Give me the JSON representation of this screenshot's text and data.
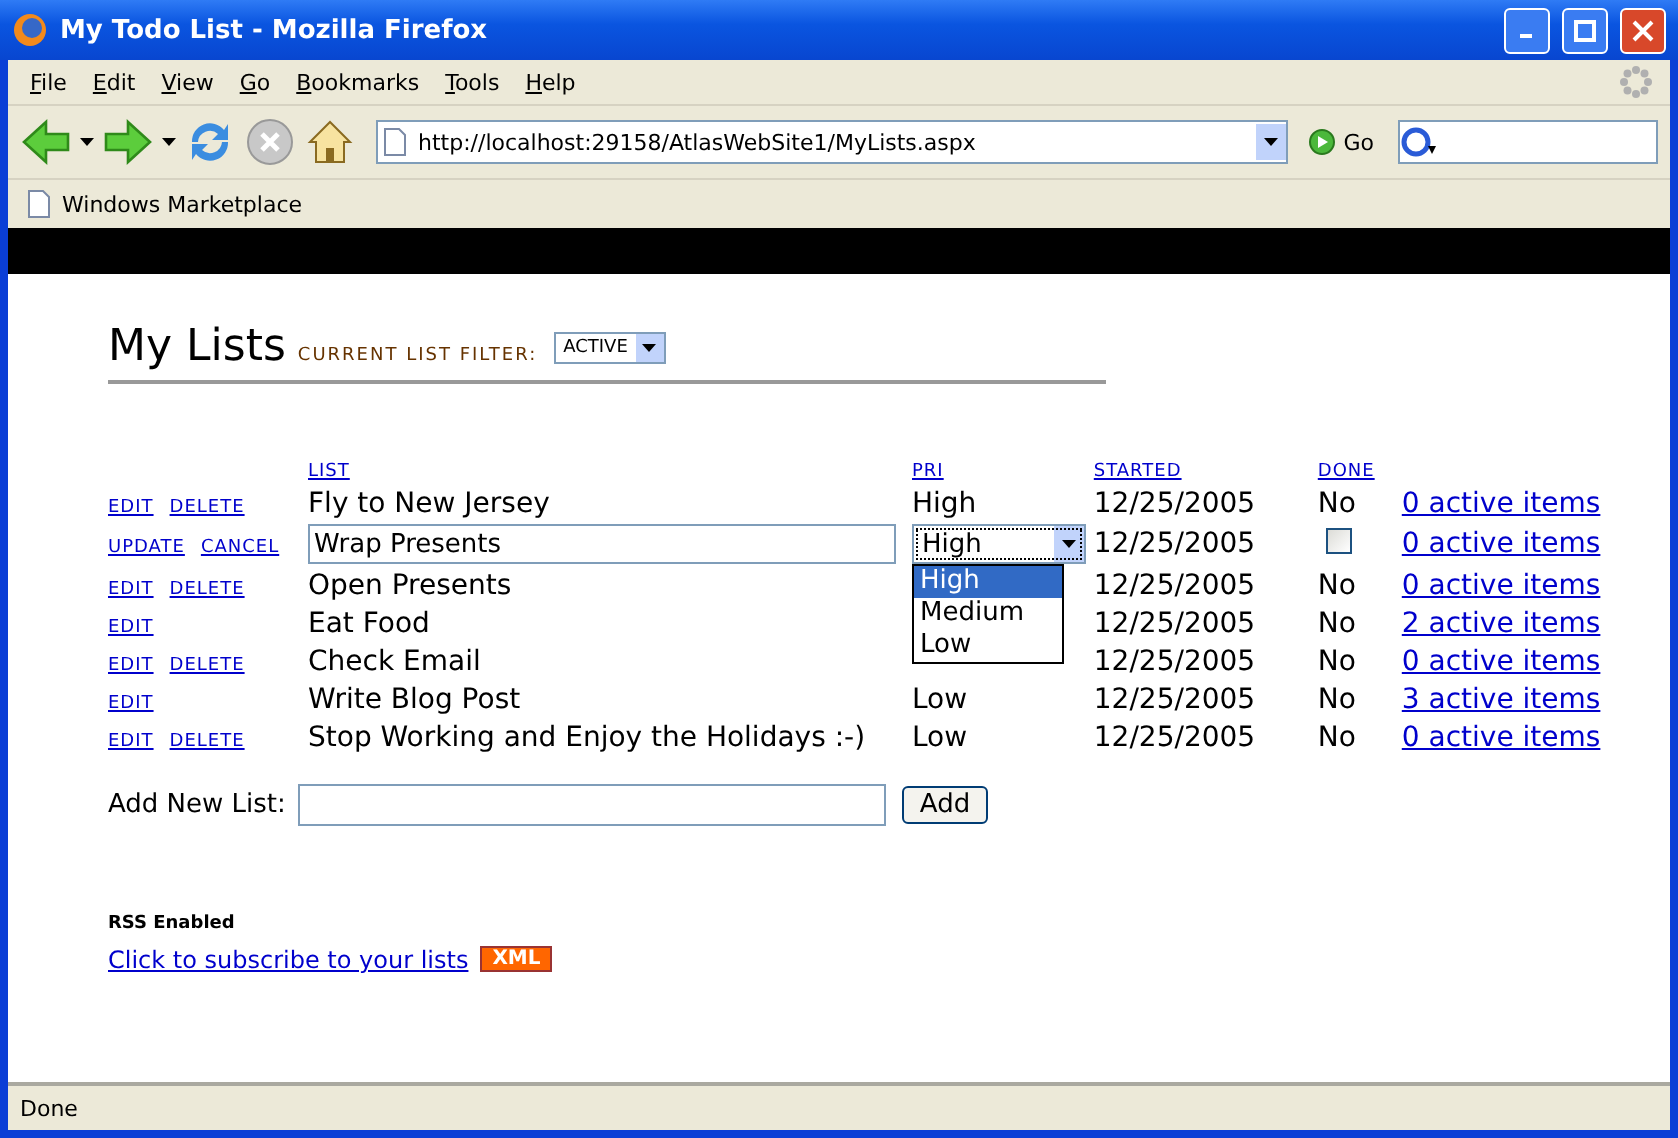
{
  "window": {
    "title": "My Todo List - Mozilla Firefox"
  },
  "menu": [
    "File",
    "Edit",
    "View",
    "Go",
    "Bookmarks",
    "Tools",
    "Help"
  ],
  "address": {
    "value": "http://localhost:29158/AtlasWebSite1/MyLists.aspx"
  },
  "go_button": "Go",
  "bookmarks": [
    "Windows Marketplace"
  ],
  "page": {
    "heading": "My Lists",
    "filter_label": "CURRENT LIST FILTER:",
    "filter_value": "ACTIVE",
    "columns": [
      "LIST",
      "PRI",
      "STARTED",
      "DONE"
    ],
    "rows": [
      {
        "kind": "view",
        "actions": [
          "EDIT",
          "DELETE"
        ],
        "name": "Fly to New Jersey",
        "pri": "High",
        "started": "12/25/2005",
        "done": "No",
        "items": "0 active items"
      },
      {
        "kind": "edit",
        "actions": [
          "UPDATE",
          "CANCEL"
        ],
        "name": "Wrap Presents",
        "pri": "High",
        "started": "12/25/2005",
        "done_checked": false,
        "items": "0 active items",
        "expanded": true,
        "pri_options": [
          {
            "label": "High",
            "selected": true
          },
          {
            "label": "Medium",
            "selected": false
          },
          {
            "label": "Low",
            "selected": false
          }
        ]
      },
      {
        "kind": "view",
        "actions": [
          "EDIT",
          "DELETE"
        ],
        "name": "Open Presents",
        "started": "12/25/2005",
        "done": "No",
        "items": "0 active items"
      },
      {
        "kind": "view",
        "actions": [
          "EDIT"
        ],
        "name": "Eat Food",
        "started": "12/25/2005",
        "done": "No",
        "items": "2 active items"
      },
      {
        "kind": "view",
        "actions": [
          "EDIT",
          "DELETE"
        ],
        "name": "Check Email",
        "started": "12/25/2005",
        "done": "No",
        "items": "0 active items"
      },
      {
        "kind": "view",
        "actions": [
          "EDIT"
        ],
        "name": "Write Blog Post",
        "pri": "Low",
        "started": "12/25/2005",
        "done": "No",
        "items": "3 active items"
      },
      {
        "kind": "view",
        "actions": [
          "EDIT",
          "DELETE"
        ],
        "name": "Stop Working and Enjoy the Holidays :-)",
        "pri": "Low",
        "started": "12/25/2005",
        "done": "No",
        "items": "0 active items"
      }
    ]
  },
  "add": {
    "label": "Add New List:",
    "button": "Add"
  },
  "rss": {
    "title": "RSS Enabled",
    "link": "Click to subscribe to your lists",
    "badge": "XML"
  },
  "status_bar": "Done"
}
